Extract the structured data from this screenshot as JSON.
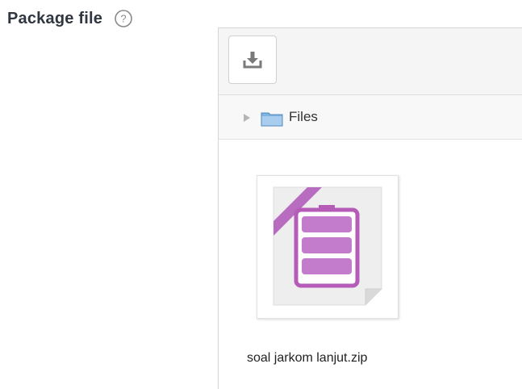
{
  "field": {
    "label": "Package file"
  },
  "toolbar": {
    "download_icon": "download-icon"
  },
  "path": {
    "folder_name": "Files"
  },
  "files": [
    {
      "name": "soal jarkom lanjut.zip",
      "icon": "zip-archive-icon"
    }
  ],
  "colors": {
    "label": "#2f3640",
    "zip_purple": "#b55bb8",
    "folder_blue": "#6aa6d8"
  }
}
